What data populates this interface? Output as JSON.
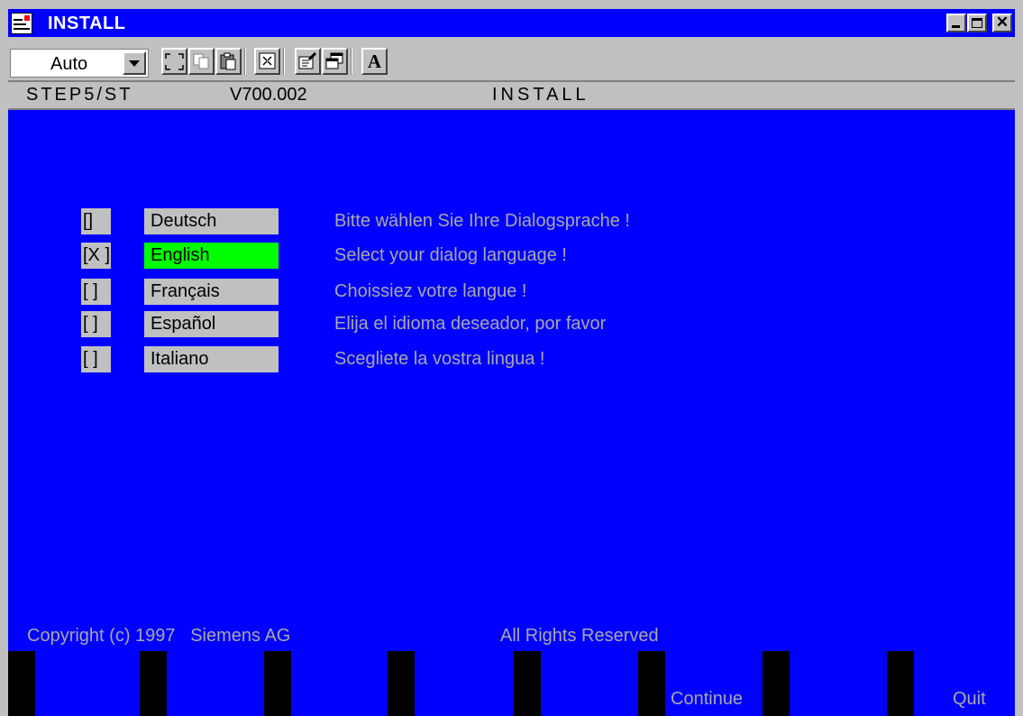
{
  "window": {
    "title": "INSTALL",
    "title_bar_color": "#0000ff",
    "icon": "step7-app-icon",
    "controls": [
      "minimize-icon",
      "maximize-icon",
      "close-icon"
    ],
    "close_glyph": "✕"
  },
  "toolbar": {
    "font_size_value": "Auto",
    "buttons": [
      "fullscreen-icon",
      "copy-icon",
      "paste-icon",
      "scale-icon",
      "properties-icon",
      "background-icon",
      "font-icon"
    ],
    "font_button_glyph": "A"
  },
  "statusline": {
    "product": "STEP5/ST",
    "version": "V700.002",
    "module": "INSTALL"
  },
  "languages": [
    {
      "check": "[]",
      "label": "Deutsch",
      "prompt": "Bitte wählen Sie Ihre Dialogsprache !",
      "selected": false
    },
    {
      "check": "[X ]",
      "label": "English",
      "prompt": "Select your dialog language !",
      "selected": true
    },
    {
      "check": "[ ]",
      "label": "Français",
      "prompt": "Choissiez votre langue !",
      "selected": false
    },
    {
      "check": "[ ]",
      "label": "Español",
      "prompt": "Elija el idioma deseador, por favor",
      "selected": false
    },
    {
      "check": "[ ]",
      "label": "Italiano",
      "prompt": "Scegliete la vostra lingua !",
      "selected": false
    }
  ],
  "footer": {
    "copyright": "Copyright (c) 1997   Siemens AG",
    "rights": "All Rights Reserved"
  },
  "function_keys": {
    "continue_label": "Continue",
    "quit_label": "Quit"
  },
  "colors": {
    "screen_background": "#0000ff",
    "selected_language": "#00ff00",
    "prompt_text": "#a8a8a8",
    "button_gray": "#c0c0c0"
  }
}
